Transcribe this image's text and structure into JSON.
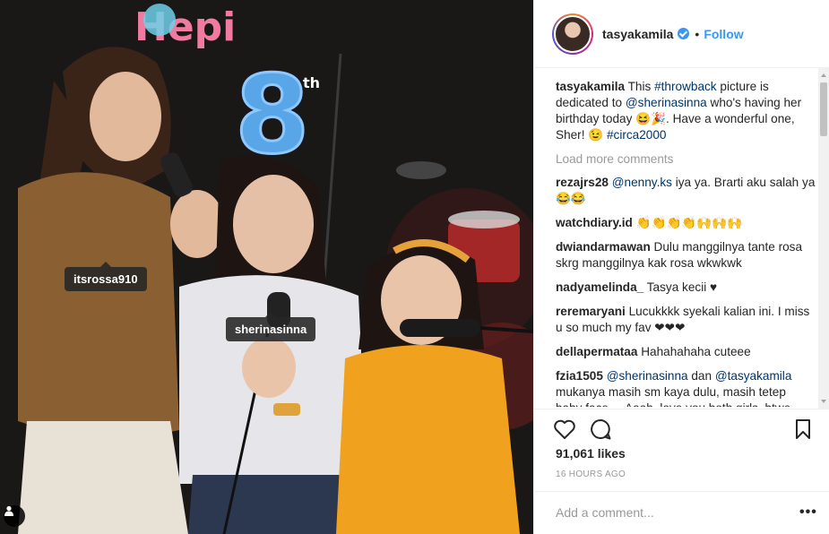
{
  "photo": {
    "banner_text": "Hepi",
    "number_text": "8",
    "number_suffix": "th",
    "tags": [
      "itsrossa910",
      "sherinasinna"
    ]
  },
  "post": {
    "username": "tasyakamila",
    "verified": true,
    "dot": "•",
    "follow_label": "Follow",
    "caption": {
      "user": "tasyakamila",
      "parts": [
        {
          "text": "This ",
          "link": false
        },
        {
          "text": "#throwback",
          "link": true
        },
        {
          "text": " picture is dedicated to ",
          "link": false
        },
        {
          "text": "@sherinasinna",
          "link": true
        },
        {
          "text": " who's having her birthday today 😆🎉. Have a wonderful one, Sher! 😉 ",
          "link": false
        },
        {
          "text": "#circa2000",
          "link": true
        }
      ]
    },
    "load_more_label": "Load more comments",
    "comments": [
      {
        "user": "rezajrs28",
        "parts": [
          {
            "text": " ",
            "link": false
          },
          {
            "text": "@nenny.ks",
            "link": true
          },
          {
            "text": " iya ya. Brarti aku salah ya😂😂",
            "link": false
          }
        ]
      },
      {
        "user": "watchdiary.id",
        "parts": [
          {
            "text": " 👏👏👏👏🙌🙌🙌",
            "link": false
          }
        ]
      },
      {
        "user": "dwiandarmawan",
        "parts": [
          {
            "text": " Dulu manggilnya tante rosa skrg manggilnya kak rosa wkwkwk",
            "link": false
          }
        ]
      },
      {
        "user": "nadyamelinda_",
        "parts": [
          {
            "text": " Tasya kecii ♥",
            "link": false
          }
        ]
      },
      {
        "user": "reremaryani",
        "parts": [
          {
            "text": " Lucukkkk syekali kalian ini. I miss u so much my fav ❤❤❤",
            "link": false
          }
        ]
      },
      {
        "user": "dellapermataa",
        "parts": [
          {
            "text": " Hahahahaha cuteee",
            "link": false
          }
        ]
      },
      {
        "user": "fzia1505",
        "parts": [
          {
            "text": " ",
            "link": false
          },
          {
            "text": "@sherinasinna",
            "link": true
          },
          {
            "text": " dan ",
            "link": false
          },
          {
            "text": "@tasyakamila",
            "link": true
          },
          {
            "text": " mukanya masih sm kaya dulu, masih tetep baby face ... Aaah, love you both girls, btwe happy bday sher. May Allah give your",
            "link": false
          }
        ]
      }
    ],
    "likes_text": "91,061 likes",
    "time_text": "16 HOURS AGO",
    "comment_placeholder": "Add a comment...",
    "more_label": "•••"
  },
  "icons": [
    "heart-icon",
    "comment-icon",
    "bookmark-icon",
    "user-tag-icon",
    "verified-badge-icon"
  ],
  "colors": {
    "link": "#003569",
    "follow": "#3897f0",
    "muted": "#999999",
    "text": "#262626"
  }
}
